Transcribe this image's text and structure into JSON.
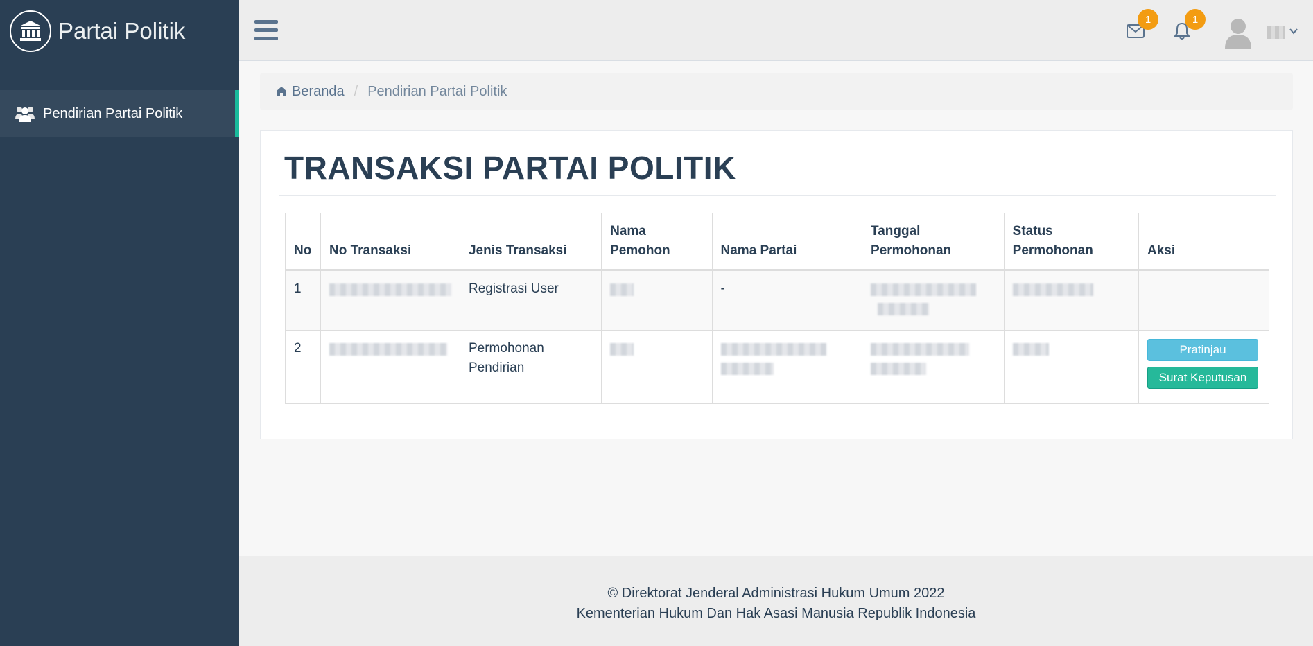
{
  "sidebar": {
    "brand_title": "Partai Politik",
    "brand_icon": "bank-icon",
    "items": [
      {
        "label": "Pendirian Partai Politik",
        "icon": "users-icon",
        "active": true
      }
    ]
  },
  "topbar": {
    "mail_badge": "1",
    "bell_badge": "1"
  },
  "breadcrumb": {
    "home": "Beranda",
    "separator": "/",
    "current": "Pendirian Partai Politik"
  },
  "panel": {
    "title": "TRANSAKSI PARTAI POLITIK"
  },
  "table": {
    "headers": [
      "No",
      "No Transaksi",
      "Jenis Transaksi",
      "Nama Pemohon",
      "Nama Partai",
      "Tanggal Permohonan",
      "Status Permohonan",
      "Aksi"
    ],
    "rows": [
      {
        "no": "1",
        "jenis": "Registrasi User",
        "nama_partai": "-"
      },
      {
        "no": "2",
        "jenis": "Permohonan Pendirian",
        "nama_partai": ""
      }
    ],
    "actions": {
      "preview": "Pratinjau",
      "decree": "Surat Keputusan"
    }
  },
  "footer": {
    "line1": "© Direktorat Jenderal Administrasi Hukum Umum 2022",
    "line2": "Kementerian Hukum Dan Hak Asasi Manusia Republik Indonesia"
  },
  "colors": {
    "sidebar": "#2a3f54",
    "accent": "#1abb9c",
    "badge": "#f39c12",
    "info": "#5bc0de",
    "success": "#26b99a"
  }
}
